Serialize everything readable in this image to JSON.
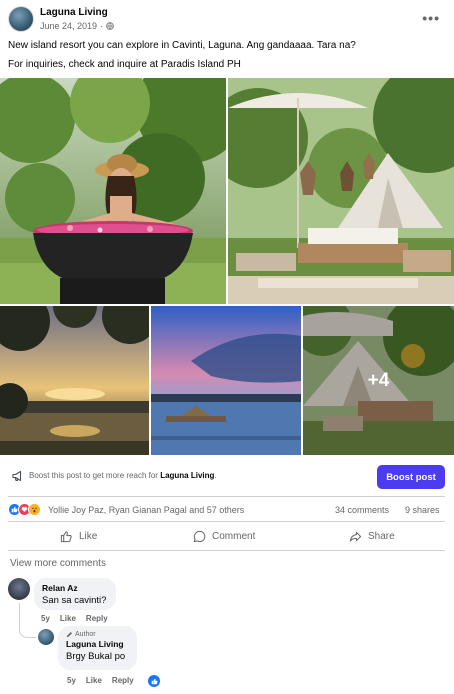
{
  "post": {
    "page_name": "Laguna Living",
    "date": "June 24, 2019",
    "more_label": "•••",
    "text_line1": "New island resort you can explore in Cavinti, Laguna. Ang gandaaaa. Tara na?",
    "text_line2": "For inquiries, check and inquire at Paradis Island PH"
  },
  "photos": {
    "more_count_label": "+4"
  },
  "boost": {
    "text_prefix": "Boost this post to get more reach for ",
    "text_page": "Laguna Living",
    "text_suffix": ".",
    "button_label": "Boost post"
  },
  "reactions": {
    "icons": [
      "like-icon",
      "love-icon",
      "wow-icon"
    ],
    "names": "Yollie Joy Paz, Ryan Gianan Pagal and 57 others",
    "comments": "34 comments",
    "shares": "9 shares"
  },
  "actions": {
    "like": "Like",
    "comment": "Comment",
    "share": "Share"
  },
  "comments": {
    "view_more": "View more comments",
    "items": [
      {
        "name": "Relan Az",
        "text": "San sa cavinti?",
        "time": "5y",
        "like": "Like",
        "reply": "Reply"
      },
      {
        "badge": "Author",
        "name": "Laguna Living",
        "text": "Brgy Bukal po",
        "time": "5y",
        "like": "Like",
        "reply": "Reply"
      }
    ]
  },
  "colors": {
    "boost_button": "#4b3cf0",
    "like_blue": "#1877f2",
    "muted_text": "#65676b"
  }
}
